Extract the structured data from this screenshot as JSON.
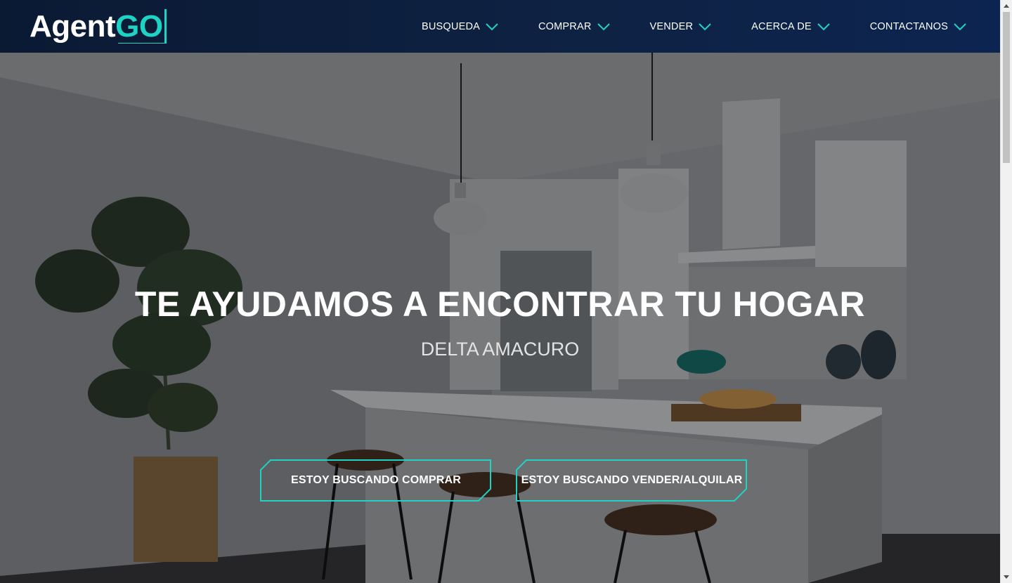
{
  "brand": {
    "logo_part1": "Agent",
    "logo_part2": "GO"
  },
  "nav": {
    "items": [
      {
        "label": "BUSQUEDA"
      },
      {
        "label": "COMPRAR"
      },
      {
        "label": "VENDER"
      },
      {
        "label": "ACERCA DE"
      },
      {
        "label": "CONTACTANOS"
      }
    ]
  },
  "hero": {
    "title": "TE AYUDAMOS A ENCONTRAR TU HOGAR",
    "subtitle": "DELTA AMACURO",
    "buttons": {
      "buy": "ESTOY BUSCANDO COMPRAR",
      "sell": "ESTOY BUSCANDO VENDER/ALQUILAR"
    }
  },
  "colors": {
    "accent": "#1fd3c4",
    "navbar": "#0e2244",
    "text": "#ffffff"
  }
}
